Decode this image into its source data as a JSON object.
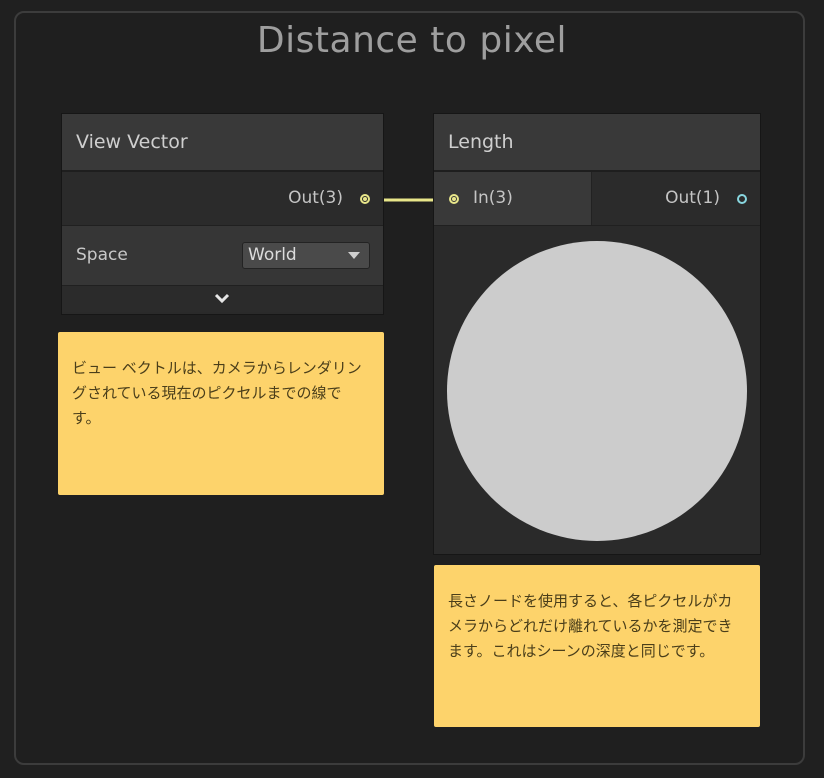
{
  "group": {
    "title": "Distance to pixel"
  },
  "view_vector_node": {
    "title": "View Vector",
    "output_port": "Out(3)",
    "property_label": "Space",
    "property_value": "World"
  },
  "length_node": {
    "title": "Length",
    "input_port": "In(3)",
    "output_port": "Out(1)"
  },
  "sticky_notes": {
    "view_vector_note": "ビュー ベクトルは、カメラからレンダリングされている現在のピクセルまでの線です。",
    "length_note": "長さノードを使用すると、各ピクセルがカメラからどれだけ離れているかを測定できます。これはシーンの深度と同じです。"
  },
  "colors": {
    "vector3_port": "#e8e68a",
    "float_port": "#88d6df",
    "sticky_note": "#fdd36b",
    "preview_disc": "#cccccc"
  },
  "icons": {
    "expand": "chevron-down-icon",
    "dropdown": "triangle-down-icon"
  }
}
